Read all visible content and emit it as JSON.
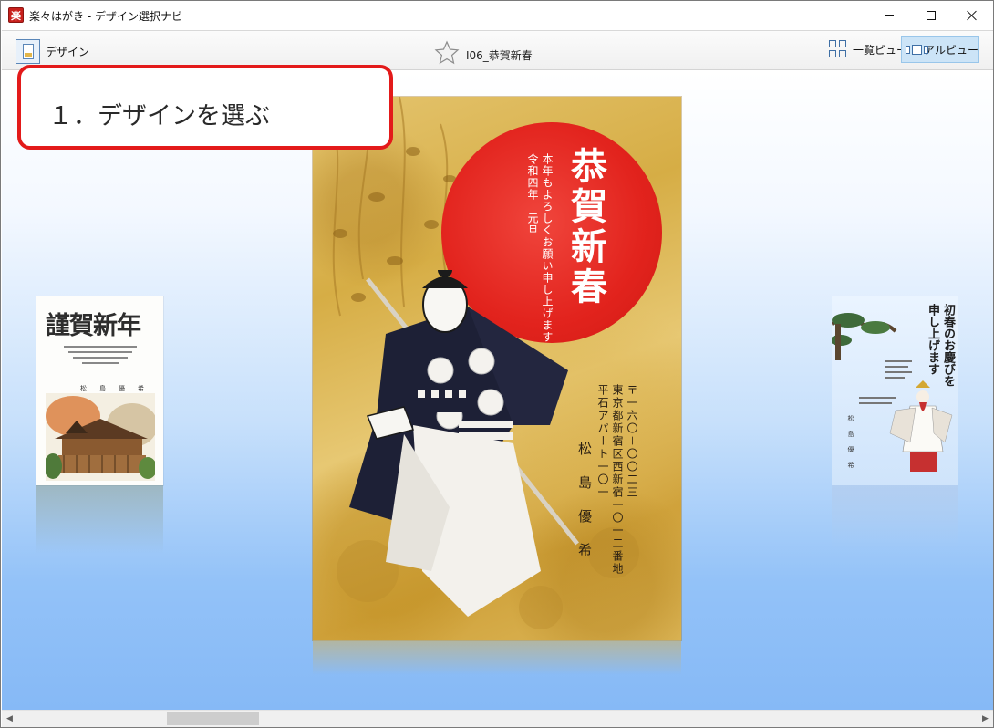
{
  "window": {
    "title": "楽々はがき - デザイン選択ナビ",
    "app_icon_glyph": "楽"
  },
  "toolbar": {
    "design_label": "デザイン",
    "card_name": "I06_恭賀新春",
    "list_view_label": "一覧ビュー",
    "real_view_label": "リアルビュー"
  },
  "callout": {
    "text": "１．デザインを選ぶ",
    "border_color": "#e31a1a"
  },
  "main_card": {
    "title": "恭賀新春",
    "body_lines": [
      "本年もよろしくお願い申し上げます",
      "令和四年　元旦"
    ],
    "address_lines": [
      "〒一六〇－〇〇二三",
      "東京都新宿区西新宿一〇一二番地",
      "平石アパート一〇一"
    ],
    "sender": "松島優希",
    "sun_color": "#e2231d"
  },
  "left_card": {
    "title": "謹賀新年",
    "sender": "松島優希"
  },
  "right_card": {
    "title_lines": [
      "初春のお慶びを",
      "申し上げます"
    ],
    "sender": "松島優希"
  },
  "icons": {
    "app": "app-icon",
    "design": "design-card-icon",
    "favorite": "star-icon",
    "list_view": "grid-icon",
    "real_view": "carousel-icon"
  }
}
